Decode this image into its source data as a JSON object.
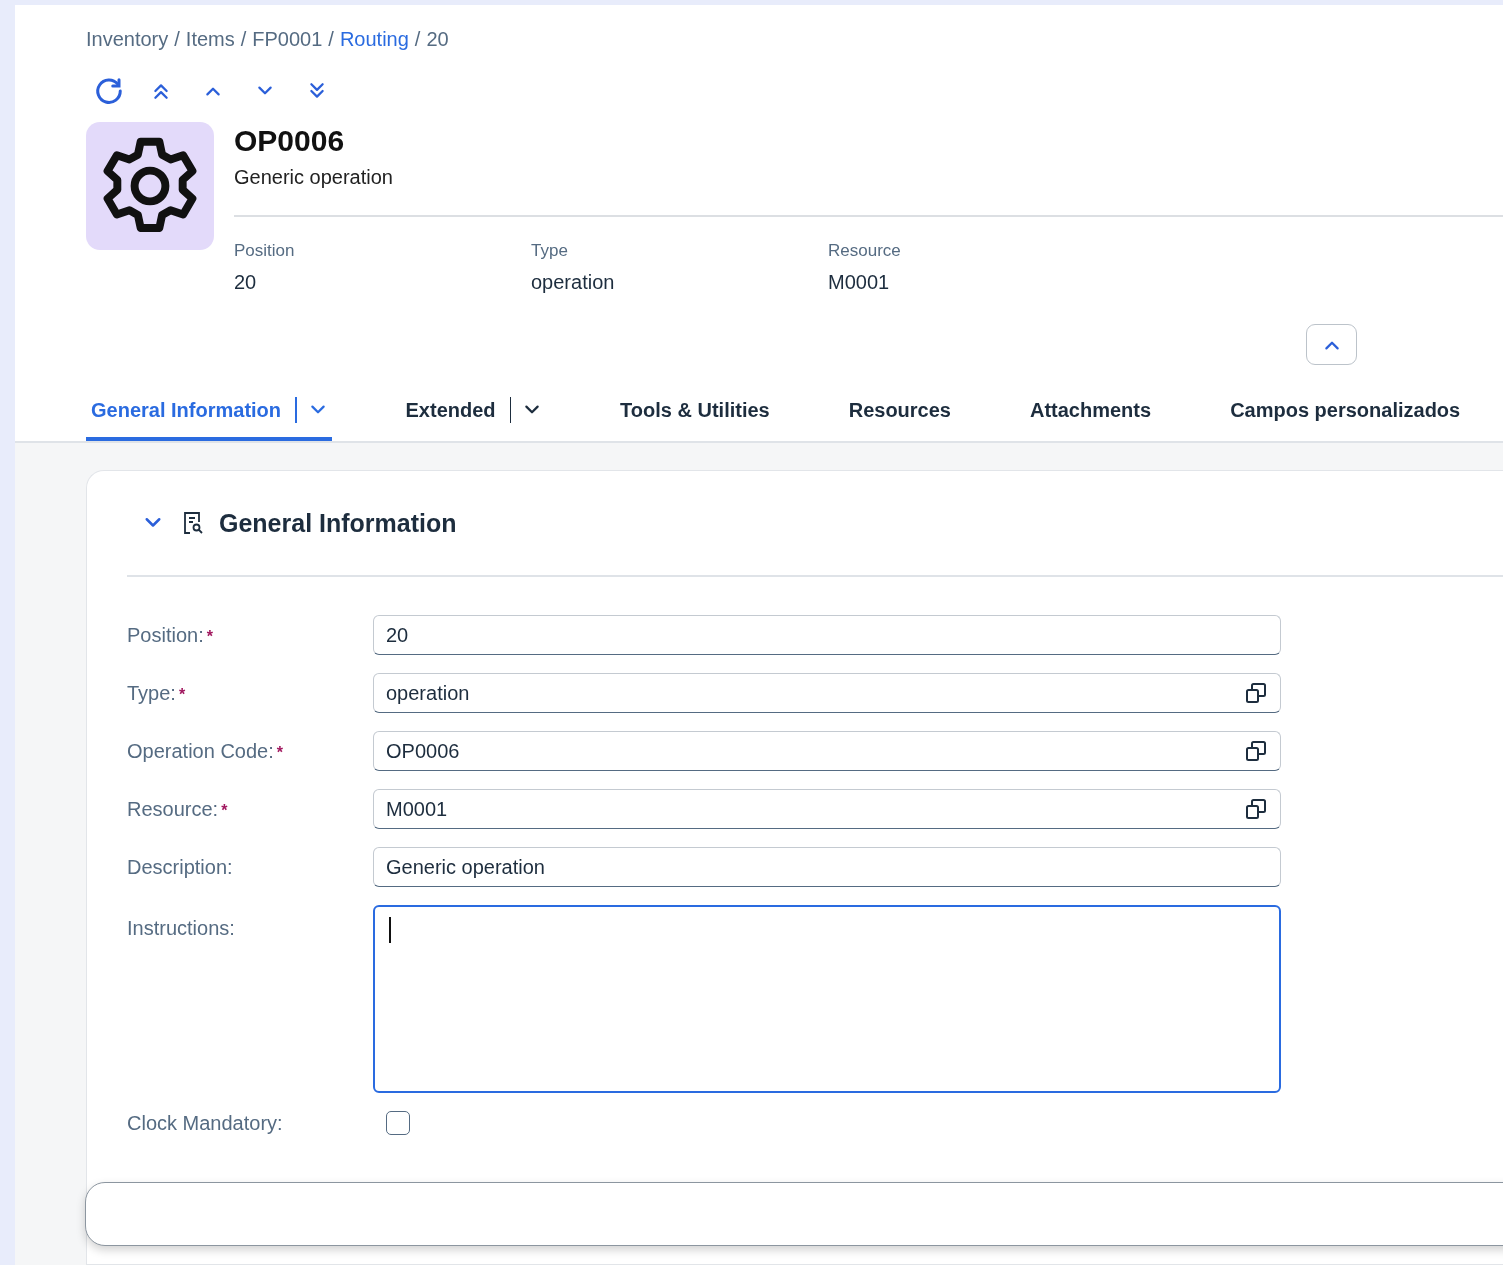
{
  "breadcrumb": [
    {
      "text": "Inventory",
      "kind": "crumb"
    },
    {
      "text": "/",
      "kind": "separator"
    },
    {
      "text": "Items",
      "kind": "crumb"
    },
    {
      "text": "/",
      "kind": "separator"
    },
    {
      "text": "FP0001",
      "kind": "crumb"
    },
    {
      "text": "/",
      "kind": "separator"
    },
    {
      "text": "Routing",
      "kind": "link"
    },
    {
      "text": "/",
      "kind": "separator"
    },
    {
      "text": "20",
      "kind": "current"
    }
  ],
  "object": {
    "title": "OP0006",
    "subtitle": "Generic operation"
  },
  "attributes": [
    {
      "label": "Position",
      "value": "20"
    },
    {
      "label": "Type",
      "value": "operation"
    },
    {
      "label": "Resource",
      "value": "M0001"
    }
  ],
  "tabs": [
    {
      "label": "General Information",
      "selected": true,
      "has_menu": true
    },
    {
      "label": "Extended",
      "selected": false,
      "has_menu": true
    },
    {
      "label": "Tools & Utilities",
      "selected": false,
      "has_menu": false
    },
    {
      "label": "Resources",
      "selected": false,
      "has_menu": false
    },
    {
      "label": "Attachments",
      "selected": false,
      "has_menu": false
    },
    {
      "label": "Campos personalizados",
      "selected": false,
      "has_menu": false
    }
  ],
  "section": {
    "title": "General Information",
    "expanded": true,
    "fields": [
      {
        "label": "Position:",
        "required_mark": "*",
        "kind": "input",
        "value": "20"
      },
      {
        "label": "Type:",
        "required_mark": "*",
        "kind": "valuehelp",
        "value": "operation"
      },
      {
        "label": "Operation Code:",
        "required_mark": "*",
        "kind": "valuehelp",
        "value": "OP0006"
      },
      {
        "label": "Resource:",
        "required_mark": "*",
        "kind": "valuehelp",
        "value": "M0001"
      },
      {
        "label": "Description:",
        "kind": "input",
        "value": "Generic operation"
      },
      {
        "label": "Instructions:",
        "kind": "textarea",
        "focused": true
      },
      {
        "label": "Clock Mandatory:",
        "kind": "checkbox",
        "checked": false
      }
    ]
  }
}
